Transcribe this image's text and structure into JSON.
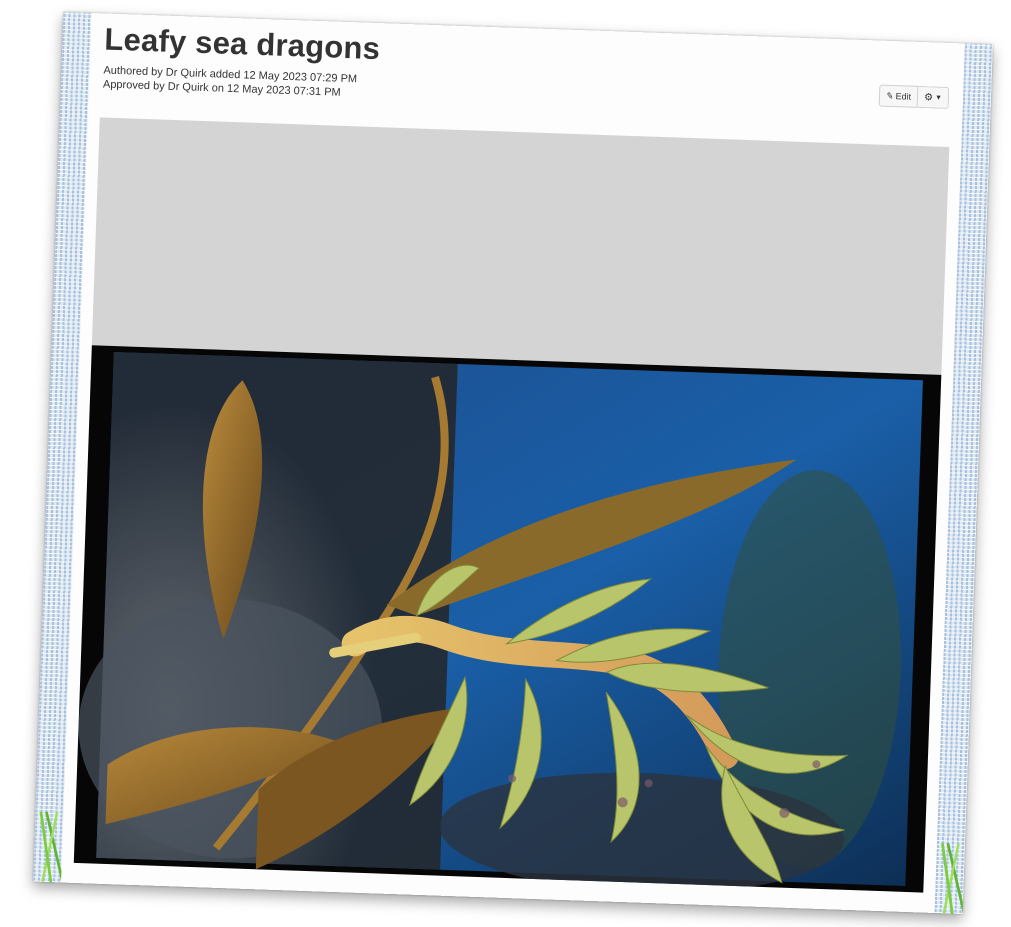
{
  "post": {
    "title": "Leafy sea dragons",
    "authored_line": "Authored by Dr Quirk added 12 May 2023 07:29 PM",
    "approved_line": "Approved by Dr Quirk on 12 May 2023 07:31 PM"
  },
  "toolbar": {
    "edit_label": "Edit",
    "edit_icon": "pencil-icon",
    "settings_icon": "gear-icon",
    "settings_caret_icon": "chevron-down-icon"
  },
  "media": {
    "subject": "leafy sea dragon among kelp",
    "placeholder_color": "#d4d4d4",
    "frame_color": "#060606"
  },
  "decor": {
    "border_color": "#dde8f2",
    "grass_color": "#7ccc3f"
  }
}
